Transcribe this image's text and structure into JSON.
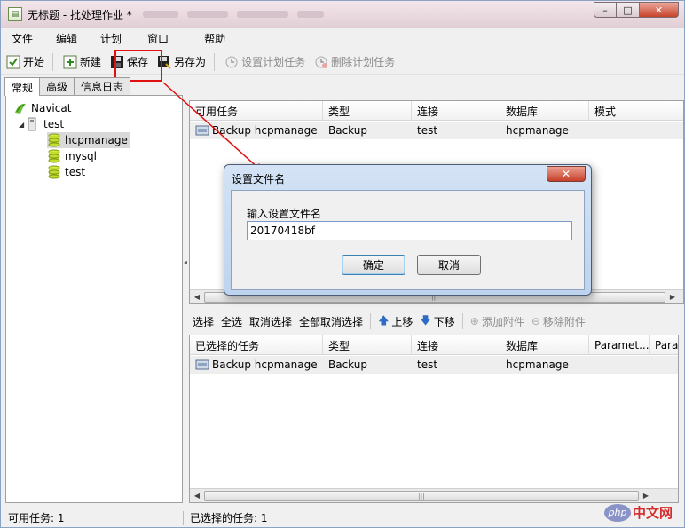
{
  "window": {
    "title": "无标题 - 批处理作业 *",
    "minimize": "–",
    "maximize": "□",
    "close": "✕"
  },
  "menu": [
    "文件",
    "编辑",
    "计划",
    "窗口",
    "帮助"
  ],
  "toolbar": {
    "start": "开始",
    "new": "新建",
    "save": "保存",
    "save_as": "另存为",
    "set_schedule": "设置计划任务",
    "delete_schedule": "删除计划任务"
  },
  "tabs": [
    "常规",
    "高级",
    "信息日志"
  ],
  "tree": {
    "root": "Navicat",
    "connection": "test",
    "databases": [
      "hcpmanage",
      "mysql",
      "test"
    ]
  },
  "available_tasks": {
    "columns": [
      "可用任务",
      "类型",
      "连接",
      "数据库",
      "模式"
    ],
    "rows": [
      [
        "Backup hcpmanage",
        "Backup",
        "test",
        "hcpmanage",
        ""
      ]
    ]
  },
  "actions": {
    "select": "选择",
    "select_all": "全选",
    "deselect": "取消选择",
    "deselect_all": "全部取消选择",
    "move_up": "上移",
    "move_down": "下移",
    "add_attachment": "添加附件",
    "remove_attachment": "移除附件"
  },
  "selected_tasks": {
    "columns": [
      "已选择的任务",
      "类型",
      "连接",
      "数据库",
      "Paramet...",
      "Para"
    ],
    "rows": [
      [
        "Backup hcpmanage",
        "Backup",
        "test",
        "hcpmanage",
        "",
        ""
      ]
    ]
  },
  "status": {
    "available": "可用任务: 1",
    "selected": "已选择的任务: 1"
  },
  "dialog": {
    "title": "设置文件名",
    "label": "输入设置文件名",
    "value": "20170418bf",
    "ok": "确定",
    "cancel": "取消",
    "close": "✕"
  },
  "watermark": {
    "badge": "php",
    "text": "中文网"
  },
  "colors": {
    "highlight": "#e01010",
    "dialog_frame": "#bed3ee",
    "close_red": "#c6402a"
  }
}
